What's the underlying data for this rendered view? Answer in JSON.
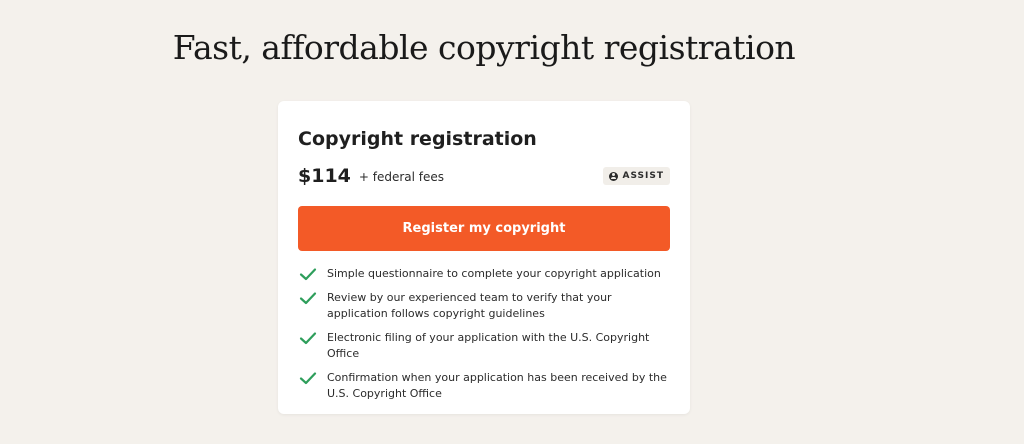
{
  "header": {
    "title": "Fast, affordable copyright registration"
  },
  "card": {
    "title": "Copyright registration",
    "price": "$114",
    "fees": "+ federal fees",
    "badge": {
      "icon": "user-circle-icon",
      "label": "ASSIST"
    },
    "cta_label": "Register my copyright",
    "features": [
      {
        "icon": "check-icon",
        "text": "Simple questionnaire to complete your copyright application"
      },
      {
        "icon": "check-icon",
        "text": "Review by our experienced team to verify that your application follows copyright guidelines"
      },
      {
        "icon": "check-icon",
        "text": "Electronic filing of your application with the U.S. Copyright Office"
      },
      {
        "icon": "check-icon",
        "text": "Confirmation when your application has been received by the U.S. Copyright Office"
      }
    ]
  },
  "colors": {
    "background": "#f4f1ec",
    "card": "#ffffff",
    "accent": "#f35a27",
    "check": "#2e9e5b",
    "badge_bg": "#f1eee9"
  }
}
